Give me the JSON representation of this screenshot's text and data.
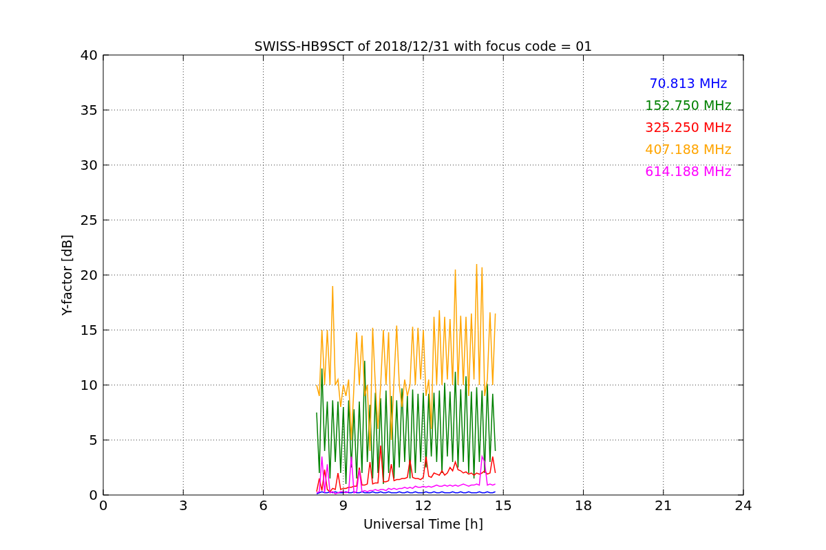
{
  "chart_data": {
    "type": "line",
    "grid": true,
    "title": "SWISS-HB9SCT of 2018/12/31 with focus code = 01",
    "xlabel": "Universal Time [h]",
    "ylabel": "Y-factor [dB]",
    "xlim": [
      0,
      24
    ],
    "ylim": [
      0,
      40
    ],
    "xticks": [
      0,
      3,
      6,
      9,
      12,
      15,
      18,
      21,
      24
    ],
    "yticks": [
      0,
      5,
      10,
      15,
      20,
      25,
      30,
      35,
      40
    ],
    "x": [
      8.0,
      8.1,
      8.2,
      8.3,
      8.4,
      8.5,
      8.6,
      8.7,
      8.8,
      8.9,
      9.0,
      9.1,
      9.2,
      9.3,
      9.4,
      9.5,
      9.6,
      9.7,
      9.8,
      9.9,
      10.0,
      10.1,
      10.2,
      10.3,
      10.4,
      10.5,
      10.6,
      10.7,
      10.8,
      10.9,
      11.0,
      11.1,
      11.2,
      11.3,
      11.4,
      11.5,
      11.6,
      11.7,
      11.8,
      11.9,
      12.0,
      12.1,
      12.2,
      12.3,
      12.4,
      12.5,
      12.6,
      12.7,
      12.8,
      12.9,
      13.0,
      13.1,
      13.2,
      13.3,
      13.4,
      13.5,
      13.6,
      13.7,
      13.8,
      13.9,
      14.0,
      14.1,
      14.2,
      14.3,
      14.4,
      14.5,
      14.6,
      14.7
    ],
    "series": [
      {
        "name": "70.813 MHz",
        "color": "#0000ff",
        "values": [
          0.1,
          0.2,
          0.3,
          0.2,
          0.2,
          0.3,
          0.2,
          0.3,
          0.2,
          0.2,
          0.2,
          0.3,
          0.2,
          0.2,
          0.3,
          0.2,
          0.2,
          0.3,
          0.2,
          0.2,
          0.2,
          0.3,
          0.2,
          0.2,
          0.3,
          0.2,
          0.2,
          0.3,
          0.2,
          0.2,
          0.2,
          0.3,
          0.2,
          0.2,
          0.3,
          0.2,
          0.2,
          0.3,
          0.2,
          0.2,
          0.2,
          0.3,
          0.2,
          0.2,
          0.3,
          0.2,
          0.2,
          0.3,
          0.2,
          0.2,
          0.2,
          0.3,
          0.2,
          0.2,
          0.3,
          0.2,
          0.2,
          0.3,
          0.2,
          0.2,
          0.2,
          0.3,
          0.2,
          0.2,
          0.3,
          0.2,
          0.2,
          0.3
        ]
      },
      {
        "name": "152.750 MHz",
        "color": "#008000",
        "values": [
          7.5,
          2,
          11.5,
          4,
          8.5,
          1.5,
          8.6,
          3,
          8.5,
          2,
          8,
          1,
          8.6,
          2.5,
          7.8,
          1.5,
          8.5,
          2,
          12.2,
          3,
          8.2,
          1.5,
          9.3,
          2,
          8.8,
          1,
          9.5,
          2,
          9,
          1.5,
          8.6,
          2.5,
          9.7,
          3,
          9,
          1.5,
          9.6,
          2,
          9.2,
          3,
          9.3,
          2.5,
          9.2,
          3.5,
          9.3,
          3,
          9.5,
          2,
          10.2,
          3.5,
          9.4,
          3,
          11.2,
          2.5,
          9.6,
          3,
          10.8,
          2,
          9.4,
          1.5,
          9.8,
          3,
          9.5,
          2,
          10.1,
          3,
          9.2,
          4
        ]
      },
      {
        "name": "325.250 MHz",
        "color": "#ff0000",
        "values": [
          0.3,
          1.5,
          0.4,
          2.3,
          0.5,
          0.3,
          0.6,
          0.5,
          2,
          0.5,
          0.6,
          0.6,
          0.7,
          0.7,
          0.8,
          0.8,
          2.5,
          0.9,
          0.9,
          1,
          3,
          1,
          1.1,
          1.1,
          4.5,
          1.2,
          1.2,
          1.3,
          2.8,
          1.3,
          1.4,
          1.4,
          1.5,
          1.5,
          1.6,
          3.2,
          1.6,
          1.5,
          1.5,
          1.4,
          1.6,
          3.5,
          1.7,
          1.6,
          2,
          1.9,
          1.8,
          2.2,
          1.8,
          2,
          2.5,
          2.2,
          3,
          2.3,
          2.2,
          2,
          2.1,
          1.9,
          2,
          1.8,
          2,
          1.9,
          2,
          2.2,
          1.9,
          2,
          3.5,
          2
        ]
      },
      {
        "name": "407.188 MHz",
        "color": "#ffa500",
        "values": [
          10,
          9,
          15,
          10,
          15,
          10,
          19,
          10,
          10.5,
          8,
          10,
          9,
          10.5,
          5,
          10,
          14.8,
          10,
          14.5,
          9,
          10,
          4,
          15.2,
          10,
          6,
          10,
          15,
          10,
          14.8,
          5,
          10.5,
          15.4,
          10,
          8,
          10.5,
          9,
          10,
          15.3,
          10,
          15.2,
          10.5,
          15,
          9,
          10.5,
          6,
          16.2,
          10,
          16.8,
          10,
          16.2,
          10.5,
          16,
          10,
          20.5,
          10,
          16.3,
          10,
          16.2,
          9,
          16.5,
          10.5,
          21,
          10,
          20.7,
          9,
          10.5,
          16.6,
          10,
          16.5
        ]
      },
      {
        "name": "614.188 MHz",
        "color": "#ff00ff",
        "values": [
          0.2,
          0.3,
          3.5,
          0.2,
          2.8,
          0.2,
          0.3,
          0.1,
          0.2,
          0.3,
          0.3,
          0.2,
          0.3,
          3.5,
          0.2,
          0.3,
          2.3,
          0.3,
          0.4,
          0.3,
          0.4,
          0.4,
          0.5,
          0.4,
          0.5,
          0.5,
          0.4,
          0.6,
          0.5,
          0.6,
          0.5,
          0.6,
          0.6,
          0.7,
          0.6,
          0.7,
          0.6,
          0.8,
          0.7,
          0.7,
          0.8,
          0.7,
          0.8,
          0.7,
          0.8,
          0.9,
          0.8,
          0.8,
          0.9,
          0.8,
          0.9,
          0.8,
          0.9,
          0.8,
          0.9,
          1,
          0.9,
          0.8,
          0.9,
          0.9,
          1,
          0.9,
          3.5,
          3,
          0.9,
          1,
          0.9,
          1
        ]
      }
    ]
  }
}
